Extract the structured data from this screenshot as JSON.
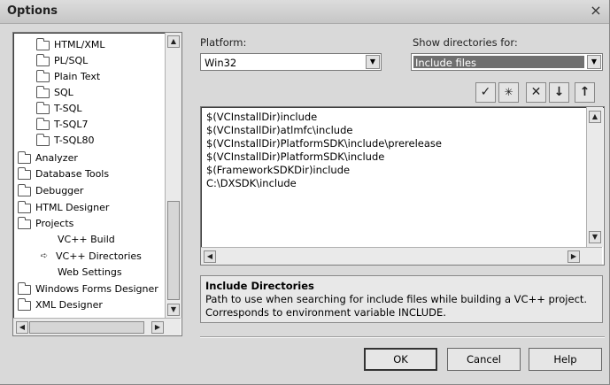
{
  "window": {
    "title": "Options",
    "close_label": "×"
  },
  "tree": {
    "items": [
      {
        "label": "HTML/XML",
        "icon": "folder-icon"
      },
      {
        "label": "PL/SQL",
        "icon": "folder-icon"
      },
      {
        "label": "Plain Text",
        "icon": "folder-icon"
      },
      {
        "label": "SQL",
        "icon": "folder-icon"
      },
      {
        "label": "T-SQL",
        "icon": "folder-icon"
      },
      {
        "label": "T-SQL7",
        "icon": "folder-icon"
      },
      {
        "label": "T-SQL80",
        "icon": "folder-icon"
      },
      {
        "label": "Analyzer",
        "icon": "folder-icon"
      },
      {
        "label": "Database Tools",
        "icon": "folder-icon"
      },
      {
        "label": "Debugger",
        "icon": "folder-icon"
      },
      {
        "label": "HTML Designer",
        "icon": "folder-icon"
      },
      {
        "label": "Projects",
        "icon": "open-folder-icon"
      },
      {
        "label": "VC++ Build",
        "icon": "none"
      },
      {
        "label": "VC++ Directories",
        "icon": "arrow-icon",
        "selected": true
      },
      {
        "label": "Web Settings",
        "icon": "none"
      },
      {
        "label": "Windows Forms Designer",
        "icon": "folder-icon"
      },
      {
        "label": "XML Designer",
        "icon": "folder-icon"
      }
    ]
  },
  "platform": {
    "label": "Platform:",
    "value": "Win32"
  },
  "show_dirs": {
    "label": "Show directories for:",
    "value": "Include files"
  },
  "toolbar": {
    "check": "✓",
    "new_line": "✳",
    "delete": "✕",
    "move_down": "↓",
    "move_up": "↑"
  },
  "directories": [
    "$(VCInstallDir)include",
    "$(VCInstallDir)atlmfc\\include",
    "$(VCInstallDir)PlatformSDK\\include\\prerelease",
    "$(VCInstallDir)PlatformSDK\\include",
    "$(FrameworkSDKDir)include",
    "C:\\DXSDK\\include"
  ],
  "description": {
    "title": "Include Directories",
    "text": "Path to use when searching for include files while building a VC++ project. Corresponds to environment variable INCLUDE."
  },
  "buttons": {
    "ok": "OK",
    "cancel": "Cancel",
    "help": "Help"
  },
  "colors": {
    "dialog_bg": "#d9d9d9",
    "selection": "#6f6f6f"
  }
}
